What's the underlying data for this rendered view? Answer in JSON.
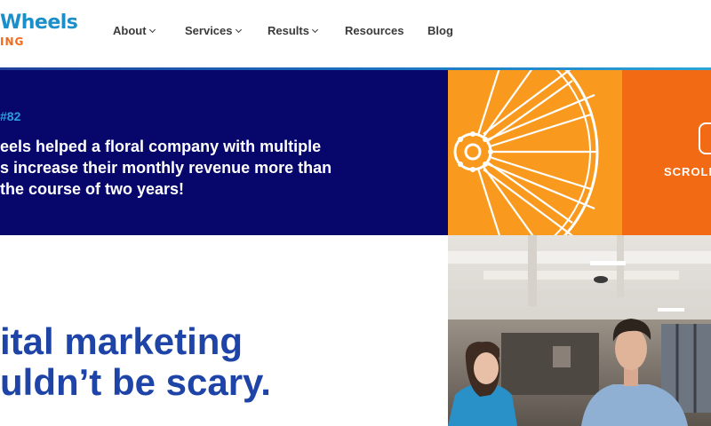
{
  "header": {
    "logo_top": "Wheels",
    "logo_bottom": "ING",
    "nav": [
      {
        "label": "About",
        "has_dropdown": true
      },
      {
        "label": "Services",
        "has_dropdown": true
      },
      {
        "label": "Results",
        "has_dropdown": true
      },
      {
        "label": "Resources",
        "has_dropdown": false
      },
      {
        "label": "Blog",
        "has_dropdown": false
      }
    ]
  },
  "case_study": {
    "label": "#82",
    "text_lines": [
      "eels helped a floral company with multiple",
      "s increase their monthly revenue more than",
      "the course of two years!"
    ]
  },
  "scroll": {
    "label": "SCROLL"
  },
  "hero": {
    "line1": "ital marketing",
    "line2": "uldn’t be scary."
  },
  "colors": {
    "brand_blue": "#1b8fc9",
    "brand_orange": "#f26b1d",
    "navy": "#07066a",
    "headline_blue": "#1e44a8",
    "panel_orange": "#f99a1e",
    "panel_deep_orange": "#f26a14"
  },
  "icons": [
    "chevron-down-icon",
    "bicycle-wheel-graphic",
    "scroll-indicator-icon"
  ]
}
